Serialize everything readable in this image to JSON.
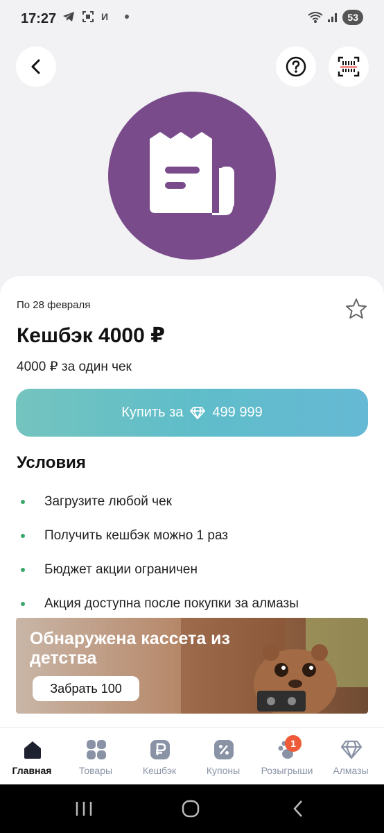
{
  "status_bar": {
    "time": "17:27",
    "carrier_letter": "И",
    "battery": "53"
  },
  "offer": {
    "date": "По 28 февраля",
    "title": "Кешбэк 4000 ₽",
    "subtitle": "4000 ₽ за один чек",
    "buy_label": "Купить за",
    "price": "499 999"
  },
  "conditions": {
    "title": "Условия",
    "items": [
      "Загрузите любой чек",
      "Получить кешбэк можно 1 раз",
      "Бюджет акции ограничен",
      "Акция доступна после покупки за алмазы"
    ]
  },
  "banner": {
    "title": "Обнаружена кассета из детства",
    "button": "Забрать 100"
  },
  "bottom_nav": {
    "items": [
      {
        "label": "Главная",
        "icon": "home-icon"
      },
      {
        "label": "Товары",
        "icon": "grid-icon"
      },
      {
        "label": "Кешбэк",
        "icon": "ruble-icon"
      },
      {
        "label": "Купоны",
        "icon": "percent-icon"
      },
      {
        "label": "Розыгрыши",
        "icon": "paw-icon",
        "badge": "1"
      },
      {
        "label": "Алмазы",
        "icon": "diamond-icon"
      }
    ]
  },
  "colors": {
    "hero": "#7a4b8b",
    "button_gradient_start": "#74c4bf",
    "button_gradient_end": "#66b9d4",
    "bullet": "#3aa86b",
    "badge": "#ef5a38"
  }
}
